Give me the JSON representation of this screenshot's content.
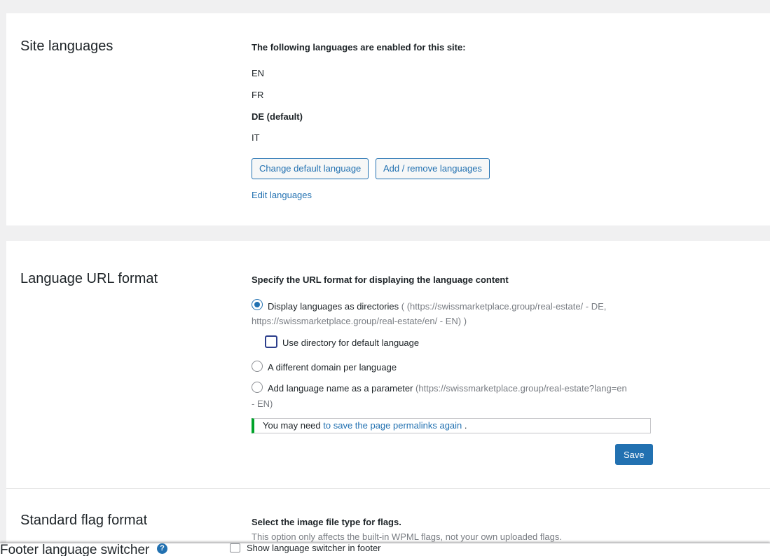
{
  "site_languages": {
    "title": "Site languages",
    "heading": "The following languages are enabled for this site:",
    "languages": [
      "EN",
      "FR",
      "DE (default)",
      "IT"
    ],
    "change_default_button": "Change default language",
    "add_remove_button": "Add / remove languages",
    "edit_link": "Edit languages"
  },
  "url_format": {
    "title": "Language URL format",
    "heading": "Specify the URL format for displaying the language content",
    "option_directories": "Display languages as directories",
    "option_directories_example_1": "( (https://swissmarketplace.group/real-estate/ - DE,",
    "option_directories_example_2": "https://swissmarketplace.group/real-estate/en/ - EN) )",
    "option_default_dir": "Use directory for default language",
    "option_domain": "A different domain per language",
    "option_parameter": "Add language name as a parameter",
    "option_parameter_example_1": "(https://swissmarketplace.group/real-estate?lang=en",
    "option_parameter_example_2": "- EN)",
    "notice_prefix": "You may need",
    "notice_link": "to save the page permalinks again",
    "notice_suffix": ".",
    "save_button": "Save"
  },
  "flag_format": {
    "title": "Standard flag format",
    "heading": "Select the image file type for flags.",
    "description": "This option only affects the built-in WPML flags, not your own uploaded flags."
  },
  "footer_switcher": {
    "title": "Footer language switcher",
    "help_icon_glyph": "?",
    "checkbox_label": "Show language switcher in footer"
  },
  "colors": {
    "accent": "#2271b1",
    "notice_border": "#00a32a",
    "page_background": "#f0f0f1"
  }
}
